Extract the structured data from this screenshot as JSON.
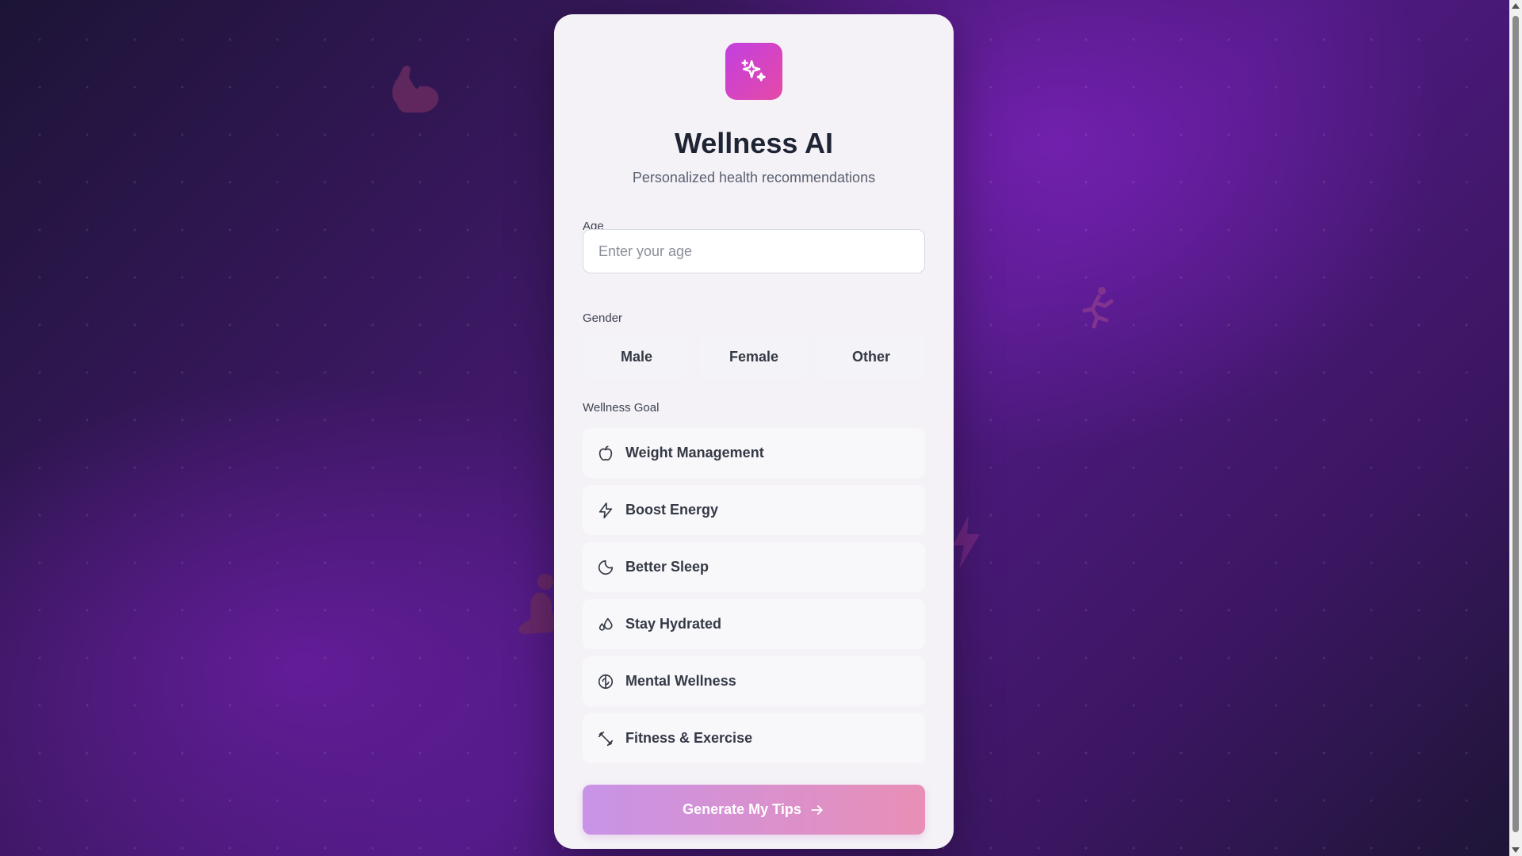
{
  "app": {
    "title": "Wellness AI",
    "subtitle": "Personalized health recommendations"
  },
  "age": {
    "label": "Age",
    "placeholder": "Enter your age",
    "value": ""
  },
  "gender": {
    "label": "Gender",
    "options": [
      "Male",
      "Female",
      "Other"
    ]
  },
  "goals": {
    "label": "Wellness Goal",
    "items": [
      {
        "label": "Weight Management",
        "icon": "apple-icon"
      },
      {
        "label": "Boost Energy",
        "icon": "lightning-icon"
      },
      {
        "label": "Better Sleep",
        "icon": "moon-icon"
      },
      {
        "label": "Stay Hydrated",
        "icon": "droplets-icon"
      },
      {
        "label": "Mental Wellness",
        "icon": "brain-icon"
      },
      {
        "label": "Fitness & Exercise",
        "icon": "dumbbell-icon"
      }
    ]
  },
  "submit": {
    "label": "Generate My Tips",
    "icon": "arrow-right-icon"
  },
  "colors": {
    "accent_start": "#c23fe0",
    "accent_end": "#e64aa6",
    "button_start": "#c893e8",
    "button_end": "#e98fb6",
    "background": "#4f1a82"
  }
}
